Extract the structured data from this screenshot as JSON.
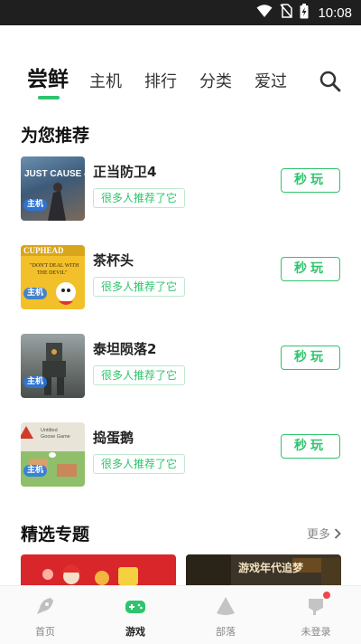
{
  "status_bar": {
    "time": "10:08"
  },
  "tabs": [
    {
      "label": "尝鲜",
      "active": true
    },
    {
      "label": "主机",
      "active": false
    },
    {
      "label": "排行",
      "active": false
    },
    {
      "label": "分类",
      "active": false
    },
    {
      "label": "爱过",
      "active": false
    }
  ],
  "recommend": {
    "title": "为您推荐",
    "games": [
      {
        "name": "正当防卫4",
        "tag": "很多人推荐了它",
        "badge": "主机",
        "button": "秒玩"
      },
      {
        "name": "茶杯头",
        "tag": "很多人推荐了它",
        "badge": "主机",
        "button": "秒玩"
      },
      {
        "name": "泰坦陨落2",
        "tag": "很多人推荐了它",
        "badge": "主机",
        "button": "秒玩"
      },
      {
        "name": "捣蛋鹅",
        "tag": "很多人推荐了它",
        "badge": "主机",
        "button": "秒玩"
      }
    ]
  },
  "featured": {
    "title": "精选专题",
    "more": "更多",
    "card2_label": "游戏年代追梦"
  },
  "bottom_nav": [
    {
      "label": "首页",
      "icon": "rocket-icon",
      "active": false
    },
    {
      "label": "游戏",
      "icon": "gamepad-icon",
      "active": true
    },
    {
      "label": "部落",
      "icon": "tribe-icon",
      "active": false
    },
    {
      "label": "未登录",
      "icon": "profile-icon",
      "active": false
    }
  ],
  "colors": {
    "accent": "#2ec46d",
    "notification_dot": "#f0454f"
  }
}
